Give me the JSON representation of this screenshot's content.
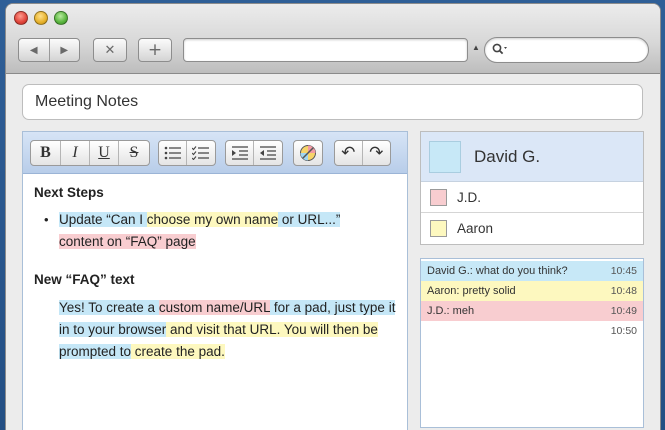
{
  "toolbar": {
    "back": "◀",
    "forward": "▶",
    "stop": "✕",
    "add": "+",
    "search_icon": "magnifier-icon",
    "url_value": ""
  },
  "pad_title": "Meeting Notes",
  "format_toolbar": {
    "bold": "B",
    "italic": "I",
    "underline": "U",
    "strike": "S",
    "undo": "↶",
    "redo": "↷"
  },
  "document": {
    "heading1": "Next Steps",
    "bullet1": [
      {
        "text": "Update “Can I ",
        "author": "blue"
      },
      {
        "text": "choose my own name",
        "author": "yellow"
      },
      {
        "text": " or URL...”",
        "author": "blue"
      },
      {
        "text": "content on “FAQ” page",
        "author": "pink"
      }
    ],
    "heading2": "New “FAQ” text",
    "para": [
      {
        "text": "Yes! To create a ",
        "author": "blue"
      },
      {
        "text": "custom name/URL",
        "author": "pink"
      },
      {
        "text": " for a pad, just type it in to your browser",
        "author": "blue"
      },
      {
        "text": " and visit that URL. You will then be ",
        "author": "yellow"
      },
      {
        "text": "prompted to",
        "author": "blue"
      },
      {
        "text": " create the pad.",
        "author": "yellow"
      }
    ]
  },
  "users": {
    "me": {
      "name": "David G.",
      "color": "#c7e8f7"
    },
    "others": [
      {
        "name": "J.D.",
        "color": "#f8cdd0"
      },
      {
        "name": "Aaron",
        "color": "#fdf8bf"
      }
    ]
  },
  "chat": [
    {
      "text": "David G.: what do you think?",
      "time": "10:45",
      "color": "#c7e8f7"
    },
    {
      "text": "Aaron: pretty solid",
      "time": "10:48",
      "color": "#fdf8bf"
    },
    {
      "text": "J.D.: meh",
      "time": "10:49",
      "color": "#f8cdd0"
    },
    {
      "text": "",
      "time": "10:50",
      "color": "#ffffff"
    }
  ]
}
